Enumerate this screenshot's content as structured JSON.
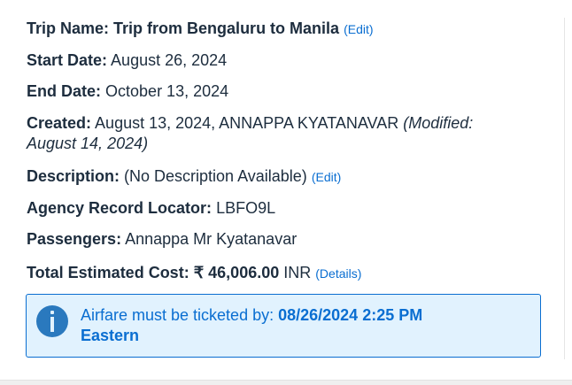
{
  "trip_name": {
    "label": "Trip Name:",
    "value": "Trip from Bengaluru to Manila",
    "edit": "(Edit)"
  },
  "start_date": {
    "label": "Start Date:",
    "value": "August 26, 2024"
  },
  "end_date": {
    "label": "End Date:",
    "value": "October 13, 2024"
  },
  "created": {
    "label": "Created:",
    "value": "August 13, 2024, ANNAPPA KYATANAVAR",
    "modified_1": "(Modified:",
    "modified_2": "August 14, 2024)"
  },
  "description": {
    "label": "Description:",
    "value": "(No Description Available)",
    "edit": "(Edit)"
  },
  "record_locator": {
    "label": "Agency Record Locator:",
    "value": "LBFO9L"
  },
  "passengers": {
    "label": "Passengers:",
    "value": "Annappa Mr Kyatanavar"
  },
  "cost": {
    "label": "Total Estimated Cost:",
    "amount": "₹ 46,006.00",
    "currency": "INR",
    "details": "(Details)"
  },
  "alert": {
    "icon": "info-icon",
    "text": "Airfare must be ticketed by:",
    "deadline": "08/26/2024 2:25 PM",
    "timezone": "Eastern"
  }
}
